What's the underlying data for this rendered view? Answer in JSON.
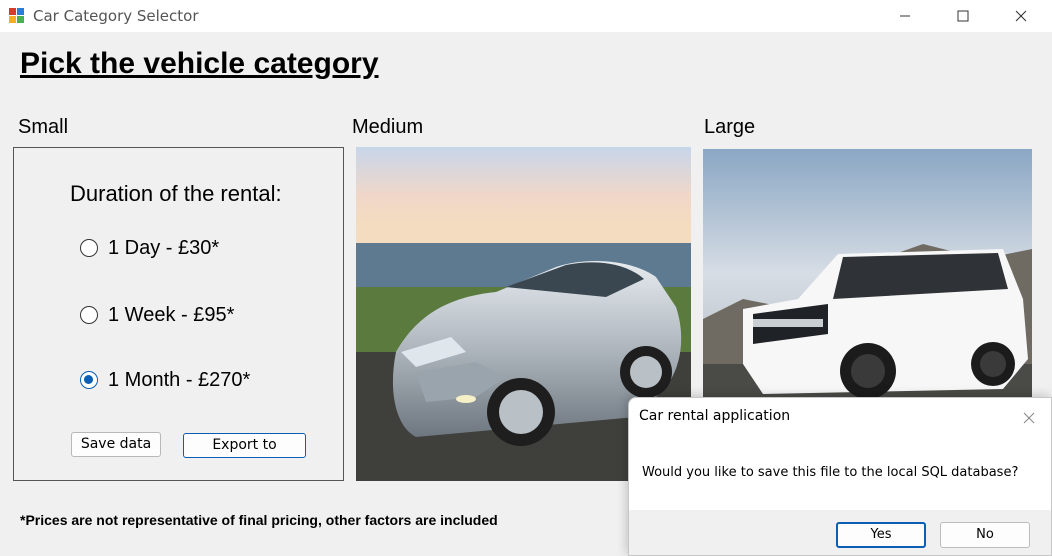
{
  "window": {
    "title": "Car Category Selector",
    "icon": "windows-form-icon",
    "controls": {
      "minimize": "minimize-icon",
      "maximize": "maximize-icon",
      "close": "close-icon"
    }
  },
  "form": {
    "heading": "Pick the vehicle category",
    "categories": [
      {
        "label": "Small"
      },
      {
        "label": "Medium",
        "image": "silver-sedan-photo"
      },
      {
        "label": "Large",
        "image": "white-suv-photo"
      }
    ],
    "duration_label": "Duration of the rental:",
    "options": [
      {
        "label": "1 Day - £30*",
        "checked": false
      },
      {
        "label": "1 Week - £95*",
        "checked": false
      },
      {
        "label": "1 Month - £270*",
        "checked": true
      }
    ],
    "save_button": "Save data",
    "export_button": "Export to",
    "disclaimer": "*Prices are not representative of final pricing, other factors are included"
  },
  "dialog": {
    "title": "Car rental application",
    "message": "Would you like to save this file to the local SQL database?",
    "yes_label": "Yes",
    "no_label": "No"
  },
  "colors": {
    "accent": "#0a5fb5",
    "form_background": "#f0f0f0",
    "dialog_background": "#ffffff"
  }
}
